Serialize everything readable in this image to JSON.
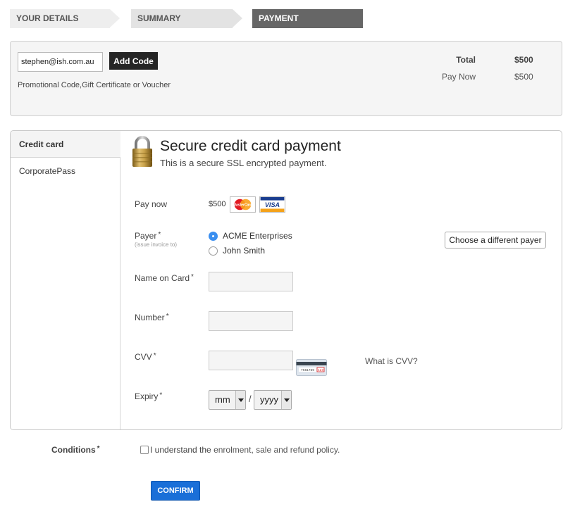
{
  "steps": [
    {
      "label": "YOUR DETAILS"
    },
    {
      "label": "SUMMARY"
    },
    {
      "label": "PAYMENT"
    }
  ],
  "promo": {
    "input_value": "stephen@ish.com.au",
    "add_code_label": "Add Code",
    "help_text": "Promotional Code,Gift Certificate or Voucher"
  },
  "totals": {
    "total_label": "Total",
    "total_value": "$500",
    "pay_now_label": "Pay Now",
    "pay_now_value": "$500"
  },
  "tabs": [
    {
      "label": "Credit card",
      "active": true
    },
    {
      "label": "CorporatePass",
      "active": false
    }
  ],
  "payment": {
    "title": "Secure credit card payment",
    "subtitle": "This is a secure SSL encrypted payment.",
    "pay_now_label": "Pay now",
    "pay_now_value": "$500",
    "mastercard_text": "MasterCard",
    "visa_text": "VISA",
    "payer_label": "Payer",
    "payer_required": "*",
    "payer_sub": "(issue invoice to)",
    "payers": [
      {
        "label": "ACME Enterprises",
        "selected": true
      },
      {
        "label": "John Smith",
        "selected": false
      }
    ],
    "choose_payer_label": "Choose a different payer",
    "name_label": "Name on Card",
    "number_label": "Number",
    "cvv_label": "CVV",
    "cvv_card_text": "7561789",
    "cvv_card_code": "123",
    "cvv_help": "What is CVV?",
    "expiry_label": "Expiry",
    "required": "*",
    "expiry_month": "mm",
    "expiry_separator": "/",
    "expiry_year": "yyyy"
  },
  "conditions": {
    "label": "Conditions",
    "required": "*",
    "text_prefix": "I understand the ",
    "link_text": "enrolment, sale and refund policy."
  },
  "confirm_label": "CONFIRM",
  "colors": {
    "active_step": "#666666",
    "confirm_button": "#1a6fd8",
    "radio_selected": "#3b8ff0",
    "add_code_button": "#252525"
  },
  "icons": [
    "padlock-icon",
    "mastercard-icon",
    "visa-icon",
    "cvv-card-icon",
    "chevron-down-icon"
  ]
}
